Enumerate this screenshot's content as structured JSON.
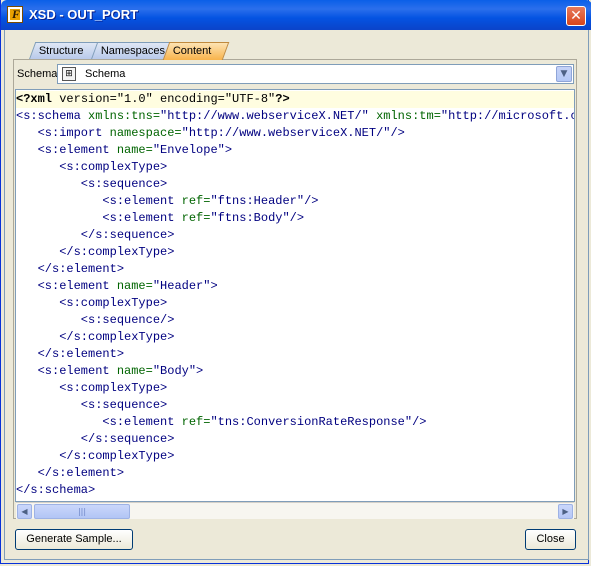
{
  "window": {
    "title": "XSD - OUT_PORT",
    "close_glyph": "✕"
  },
  "tabs": [
    {
      "label": "Structure",
      "active": false
    },
    {
      "label": "Namespaces",
      "active": false
    },
    {
      "label": "Content",
      "active": true
    }
  ],
  "schema_selector": {
    "label": "Schema",
    "value": "Schema"
  },
  "editor": {
    "lines": [
      [
        {
          "t": "<?xml",
          "c": "pi"
        },
        {
          "t": " version=\"1.0\" encoding=\"UTF-8\"",
          "c": "plain"
        },
        {
          "t": "?>",
          "c": "pi"
        }
      ],
      [
        {
          "t": "<s:schema ",
          "c": "lt"
        },
        {
          "t": "xmlns:tns=",
          "c": "attr"
        },
        {
          "t": "\"http://www.webserviceX.NET/\" ",
          "c": "val"
        },
        {
          "t": "xmlns:tm=",
          "c": "attr"
        },
        {
          "t": "\"http://microsoft.co",
          "c": "val"
        }
      ],
      [
        {
          "t": "   <s:import ",
          "c": "lt"
        },
        {
          "t": "namespace=",
          "c": "attr"
        },
        {
          "t": "\"http://www.webserviceX.NET/\"/>",
          "c": "val"
        }
      ],
      [
        {
          "t": "   <s:element ",
          "c": "lt"
        },
        {
          "t": "name=",
          "c": "attr"
        },
        {
          "t": "\"Envelope\">",
          "c": "val"
        }
      ],
      [
        {
          "t": "      <s:complexType>",
          "c": "lt"
        }
      ],
      [
        {
          "t": "         <s:sequence>",
          "c": "lt"
        }
      ],
      [
        {
          "t": "            <s:element ",
          "c": "lt"
        },
        {
          "t": "ref=",
          "c": "attr"
        },
        {
          "t": "\"ftns:Header\"/>",
          "c": "val"
        }
      ],
      [
        {
          "t": "            <s:element ",
          "c": "lt"
        },
        {
          "t": "ref=",
          "c": "attr"
        },
        {
          "t": "\"ftns:Body\"/>",
          "c": "val"
        }
      ],
      [
        {
          "t": "         </s:sequence>",
          "c": "lt"
        }
      ],
      [
        {
          "t": "      </s:complexType>",
          "c": "lt"
        }
      ],
      [
        {
          "t": "   </s:element>",
          "c": "lt"
        }
      ],
      [
        {
          "t": "   <s:element ",
          "c": "lt"
        },
        {
          "t": "name=",
          "c": "attr"
        },
        {
          "t": "\"Header\">",
          "c": "val"
        }
      ],
      [
        {
          "t": "      <s:complexType>",
          "c": "lt"
        }
      ],
      [
        {
          "t": "         <s:sequence/>",
          "c": "lt"
        }
      ],
      [
        {
          "t": "      </s:complexType>",
          "c": "lt"
        }
      ],
      [
        {
          "t": "   </s:element>",
          "c": "lt"
        }
      ],
      [
        {
          "t": "   <s:element ",
          "c": "lt"
        },
        {
          "t": "name=",
          "c": "attr"
        },
        {
          "t": "\"Body\">",
          "c": "val"
        }
      ],
      [
        {
          "t": "      <s:complexType>",
          "c": "lt"
        }
      ],
      [
        {
          "t": "         <s:sequence>",
          "c": "lt"
        }
      ],
      [
        {
          "t": "            <s:element ",
          "c": "lt"
        },
        {
          "t": "ref=",
          "c": "attr"
        },
        {
          "t": "\"tns:ConversionRateResponse\"/>",
          "c": "val"
        }
      ],
      [
        {
          "t": "         </s:sequence>",
          "c": "lt"
        }
      ],
      [
        {
          "t": "      </s:complexType>",
          "c": "lt"
        }
      ],
      [
        {
          "t": "   </s:element>",
          "c": "lt"
        }
      ],
      [
        {
          "t": "</s:schema>",
          "c": "lt"
        }
      ]
    ]
  },
  "buttons": {
    "generate_sample": "Generate Sample...",
    "close": "Close"
  },
  "colors": {
    "titlebar": "#0453e2",
    "active_tab": "#f8b34b",
    "tag": "#000080",
    "attribute": "#006400"
  }
}
